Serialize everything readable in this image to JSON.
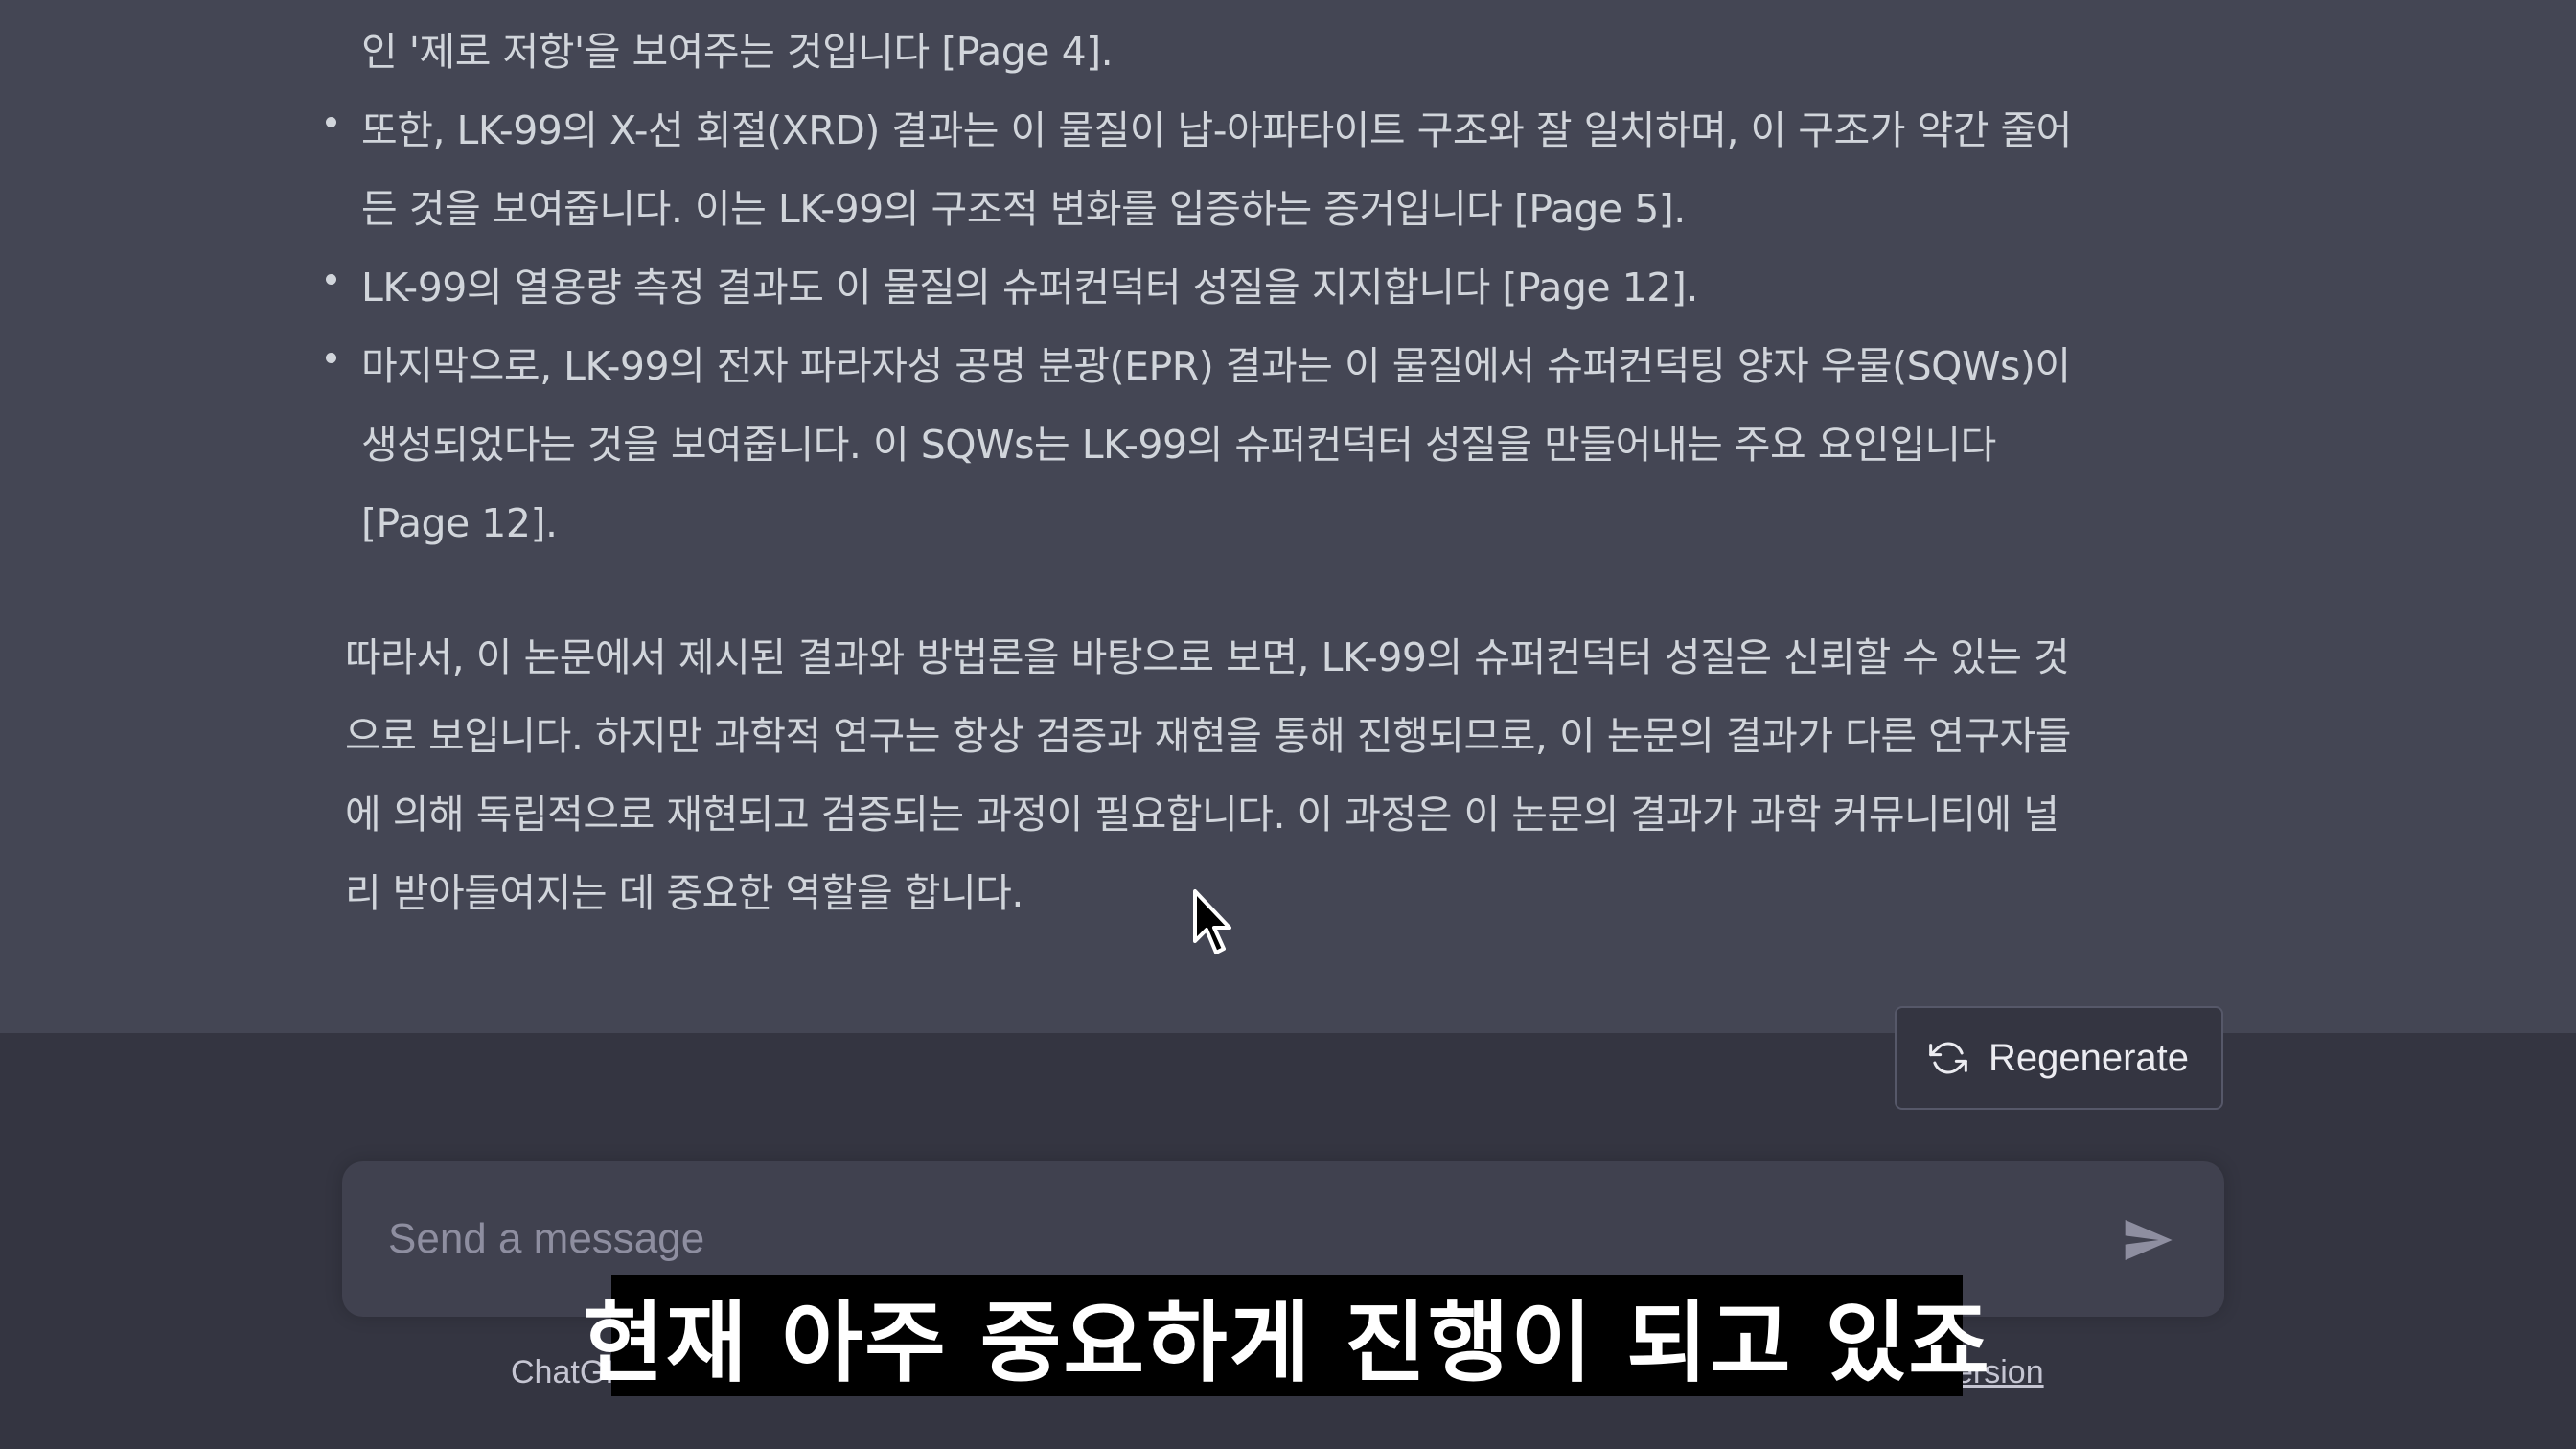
{
  "message": {
    "bullet_lines": [
      "인 '제로 저항'을 보여주는 것입니다 [Page 4].",
      "또한, LK-99의 X-선 회절(XRD) 결과는 이 물질이 납-아파타이트 구조와 잘 일치하며, 이 구조가 약간 줄어",
      "든 것을 보여줍니다. 이는 LK-99의 구조적 변화를 입증하는 증거입니다 [Page 5].",
      "LK-99의 열용량 측정 결과도 이 물질의 슈퍼컨덕터 성질을 지지합니다 [Page 12].",
      "마지막으로, LK-99의 전자 파라자성 공명 분광(EPR) 결과는 이 물질에서 슈퍼컨덕팅 양자 우물(SQWs)이",
      "생성되었다는 것을 보여줍니다. 이 SQWs는 LK-99의 슈퍼컨덕터 성질을 만들어내는 주요 요인입니다",
      "[Page 12]."
    ],
    "paragraph_lines": [
      "따라서, 이 논문에서 제시된 결과와 방법론을 바탕으로 보면, LK-99의 슈퍼컨덕터 성질은 신뢰할 수 있는 것",
      "으로 보입니다. 하지만 과학적 연구는 항상 검증과 재현을 통해 진행되므로, 이 논문의 결과가 다른 연구자들",
      "에 의해 독립적으로 재현되고 검증되는 과정이 필요합니다. 이 과정은 이 논문의 결과가 과학 커뮤니티에 널",
      "리 받아들여지는 데 중요한 역할을 합니다."
    ]
  },
  "regenerate": {
    "label": "Regenerate",
    "icon": "refresh-icon"
  },
  "input": {
    "placeholder": "Send a message",
    "send_icon": "send-icon"
  },
  "footer": {
    "left_text": "ChatGI",
    "right_link": "ersion"
  },
  "subtitle": {
    "text": "현재 아주 중요하게 진행이 되고 있죠"
  },
  "colors": {
    "message_bg": "#444654",
    "page_bg": "#343541",
    "input_bg": "#40414f",
    "text": "#d1d5db"
  }
}
